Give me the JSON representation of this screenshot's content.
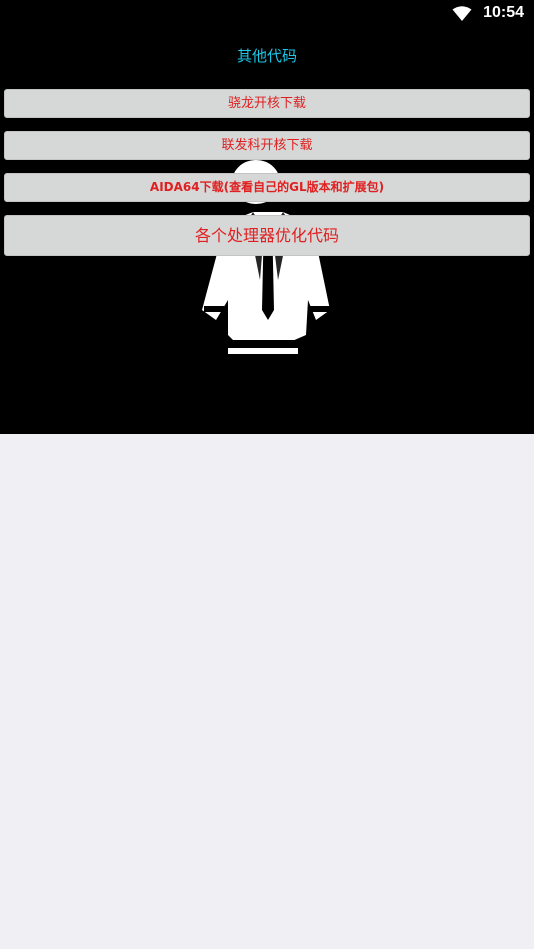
{
  "status_bar": {
    "time": "10:54",
    "icons": [
      "wifi-icon"
    ]
  },
  "header": {
    "title": "其他代码"
  },
  "buttons": [
    {
      "label": "骁龙开核下载"
    },
    {
      "label": "联发科开核下载"
    },
    {
      "label": "AIDA64下载(查看自己的GL版本和扩展包)"
    },
    {
      "label": "各个处理器优化代码"
    }
  ],
  "colors": {
    "title": "#19c8e8",
    "button_text": "#e02020",
    "button_bg": "#d6d7d7",
    "header_bg": "#000000",
    "page_bg": "#efeff4"
  }
}
